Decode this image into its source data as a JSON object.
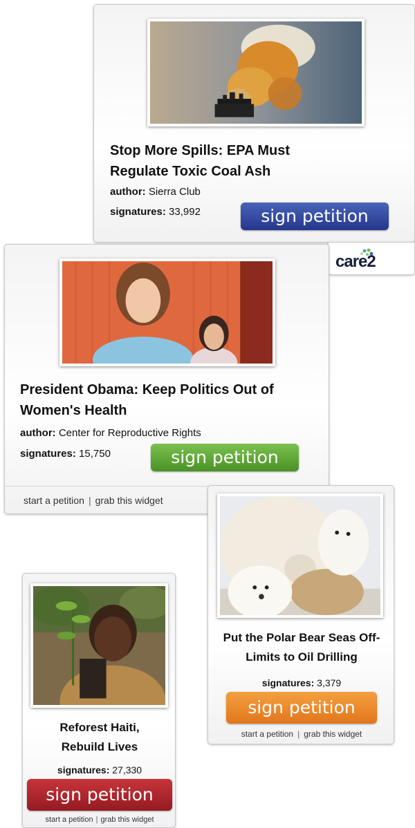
{
  "brand": {
    "logo_text": "care2"
  },
  "petitions": [
    {
      "title": "Stop More Spills: EPA Must Regulate Toxic Coal Ash",
      "author_label": "author:",
      "author": "Sierra Club",
      "signatures_label": "signatures:",
      "signatures": "33,992",
      "button_label": "sign petition",
      "button_color": "#2b3f93",
      "photo_icon": "smokestack-photo"
    },
    {
      "title": "President Obama: Keep Politics Out of Women's Health",
      "author_label": "author:",
      "author": "Center for Reproductive Rights",
      "signatures_label": "signatures:",
      "signatures": "15,750",
      "button_label": "sign petition",
      "button_color": "#5aa132",
      "start_link": "start a petition",
      "separator": "|",
      "grab_link": "grab this widget",
      "photo_icon": "women-photo"
    },
    {
      "title": "Put the Polar Bear Seas Off-Limits to Oil Drilling",
      "signatures_label": "signatures:",
      "signatures": "3,379",
      "button_label": "sign petition",
      "button_color": "#ea8426",
      "start_link": "start a petition",
      "separator": "|",
      "grab_link": "grab this widget",
      "photo_icon": "polar-bears-photo"
    },
    {
      "title": "Reforest Haiti, Rebuild Lives",
      "signatures_label": "signatures:",
      "signatures": "27,330",
      "button_label": "sign petition",
      "button_color": "#b1262c",
      "start_link": "start a petition",
      "separator": "|",
      "grab_link": "grab this widget",
      "photo_icon": "child-sapling-photo"
    }
  ]
}
